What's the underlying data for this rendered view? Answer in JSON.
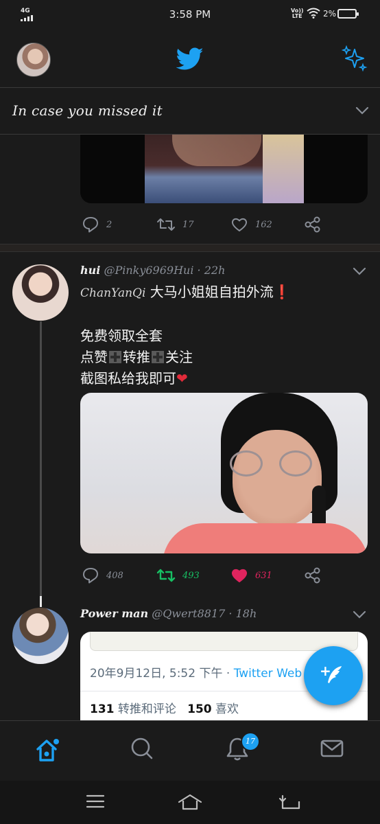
{
  "status_bar": {
    "network": "4G",
    "time": "3:58 PM",
    "volte": "VoLTE",
    "volte_top": "Vo))",
    "volte_bottom": "LTE",
    "battery": "2%"
  },
  "app_bar": {
    "profile_icon": "avatar",
    "logo_icon": "twitter-bird-icon",
    "sparkle_icon": "sparkle-icon"
  },
  "section": {
    "title": "In case you missed it"
  },
  "tweet1": {
    "reply_count": "2",
    "retweet_count": "17",
    "like_count": "162"
  },
  "tweet2": {
    "name": "hui",
    "handle": "@Pinky6969Hui",
    "separator": "·",
    "time": "22h",
    "mention": "ChanYanQi",
    "line1_rest": "大马小姐姐自拍外流",
    "line1_mark": "❗",
    "line3": "免费领取全套",
    "line4_a": "点赞",
    "line4_b": "转推",
    "line4_c": "关注",
    "line5": "截图私给我即可",
    "line5_heart": "❤",
    "reply_count": "408",
    "retweet_count": "493",
    "like_count": "631",
    "retweet_color": "#17bf63",
    "like_color": "#e0245e"
  },
  "tweet3": {
    "name": "Power man",
    "handle": "@Qwert8817",
    "separator": "·",
    "time": "18h",
    "quote_date": "20年9月12日, 5:52 下午",
    "quote_sep": "·",
    "quote_source": "Twitter Web",
    "quote_retweets_num": "131",
    "quote_retweets_label": "转推和评论",
    "quote_likes_num": "150",
    "quote_likes_label": "喜欢"
  },
  "fab": {
    "icon": "compose-tweet-icon",
    "plus": "+"
  },
  "tab_bar": {
    "home_icon": "home-icon",
    "search_icon": "search-icon",
    "notifications_icon": "bell-icon",
    "notifications_badge": "17",
    "messages_icon": "mail-icon"
  },
  "nav_bar": {
    "menu_icon": "menu-icon",
    "home_icon": "home-outline-icon",
    "back_icon": "back-icon"
  },
  "colors": {
    "accent": "#1da1f2",
    "background": "#1b1b1b"
  }
}
